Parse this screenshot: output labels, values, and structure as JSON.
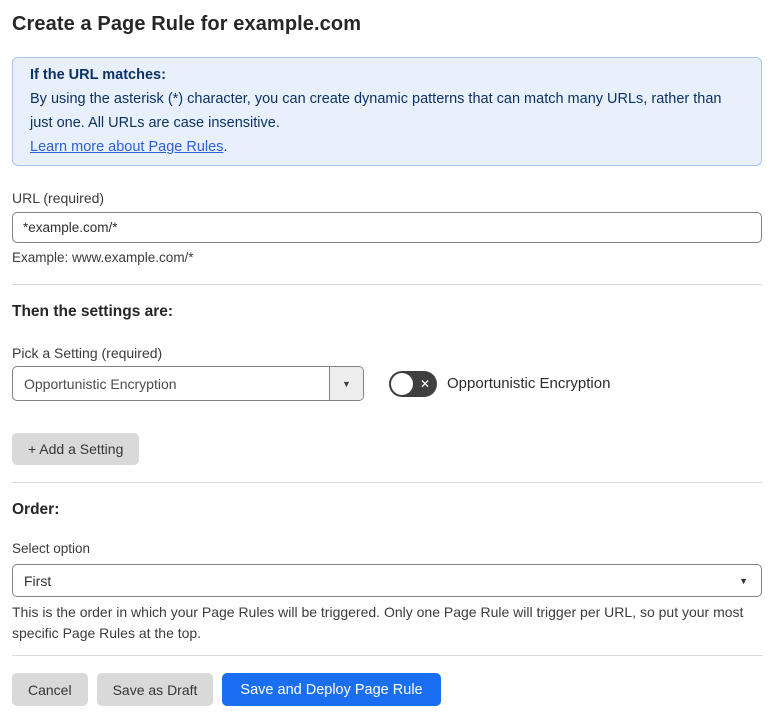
{
  "page": {
    "title": "Create a Page Rule for example.com"
  },
  "info_box": {
    "heading": "If the URL matches:",
    "body": "By using the asterisk (*) character, you can create dynamic patterns that can match many URLs, rather than just one. All URLs are case insensitive.",
    "link_label": "Learn more about Page Rules",
    "link_suffix": "."
  },
  "url_field": {
    "label": "URL (required)",
    "value": "*example.com/*",
    "helper": "Example: www.example.com/*"
  },
  "settings_section": {
    "heading": "Then the settings are:",
    "picker_label": "Pick a Setting (required)",
    "picker_value": "Opportunistic Encryption",
    "picker_arrow": "▼",
    "toggle_state": "off",
    "toggle_x": "✕",
    "toggle_label": "Opportunistic Encryption",
    "add_setting_button": "+ Add a Setting"
  },
  "order_section": {
    "heading": "Order:",
    "select_label": "Select option",
    "select_value": "First",
    "select_arrow": "▼",
    "helper": "This is the order in which your Page Rules will be triggered. Only one Page Rule will trigger per URL, so put your most specific Page Rules at the top."
  },
  "actions": {
    "cancel": "Cancel",
    "save_draft": "Save as Draft",
    "save_deploy": "Save and Deploy Page Rule"
  },
  "colors": {
    "accent_blue": "#1a6ef2",
    "info_background": "#e8f1fb",
    "info_border": "#a6c6ea",
    "info_text": "#0c3264",
    "link_blue": "#2d60d8",
    "toggle_off_background": "#3f3f3f",
    "gray_button": "#d9d9d9"
  }
}
